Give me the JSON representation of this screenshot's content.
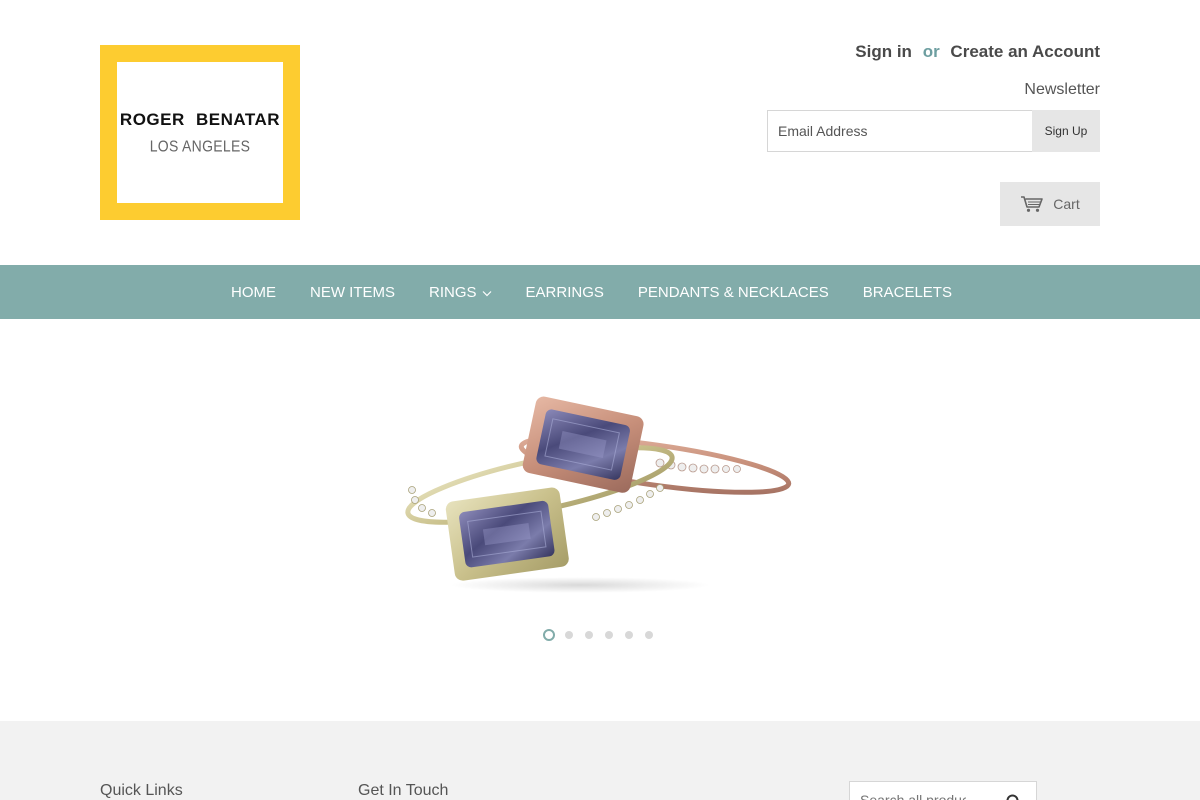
{
  "header": {
    "logo": {
      "name": "ROGER  BENATAR",
      "city": "LOS ANGELES",
      "frame_color": "#fdcc30"
    },
    "account": {
      "sign_in": "Sign in",
      "or": "or",
      "create_account": "Create an Account"
    },
    "newsletter": {
      "label": "Newsletter",
      "email_placeholder": "Email Address",
      "signup_label": "Sign Up"
    },
    "cart": {
      "label": "Cart",
      "icon": "cart-icon"
    }
  },
  "nav": {
    "background": "#82acaa",
    "items": [
      {
        "label": "HOME"
      },
      {
        "label": "NEW ITEMS"
      },
      {
        "label": "RINGS",
        "has_dropdown": true
      },
      {
        "label": "EARRINGS"
      },
      {
        "label": "PENDANTS & NECKLACES"
      },
      {
        "label": "BRACELETS"
      }
    ]
  },
  "slideshow": {
    "slide_count": 6,
    "active_slide": 1
  },
  "footer": {
    "quick_links_title": "Quick Links",
    "get_in_touch_title": "Get In Touch",
    "search_placeholder": "Search all products..."
  }
}
